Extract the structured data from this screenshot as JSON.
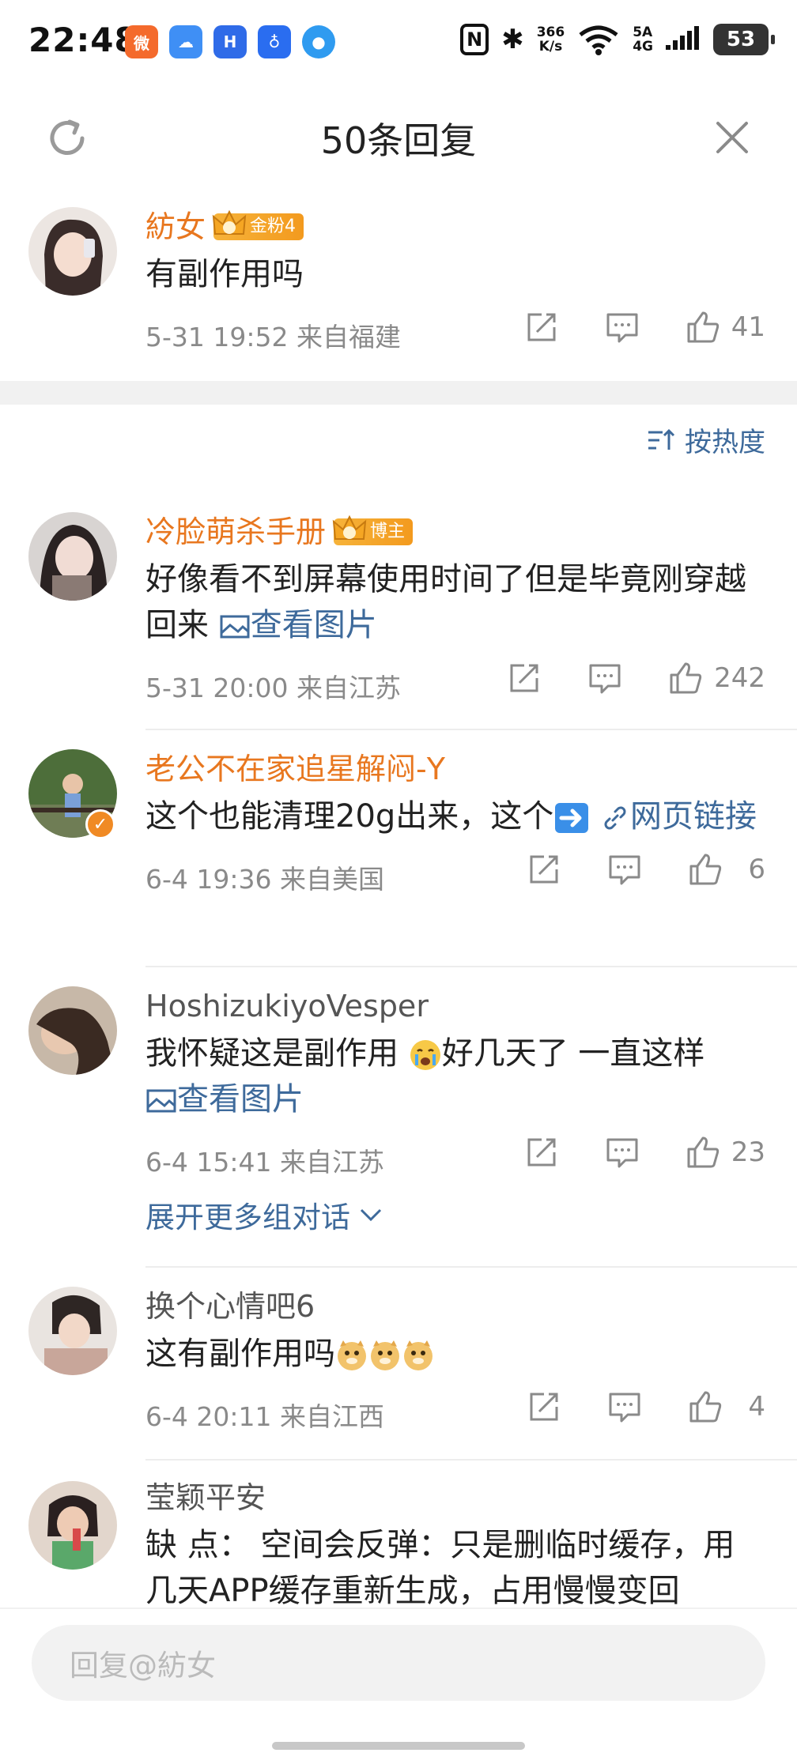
{
  "status_bar": {
    "time": "22:48",
    "net_speed_top": "366",
    "net_speed_bottom": "K/s",
    "signal_top": "5A",
    "signal_bottom": "4G",
    "battery": "53",
    "app_icon_colors": [
      "#f46a2c",
      "#3f8ff5",
      "#2f6be8",
      "#2a6df0",
      "#2f9bf0"
    ]
  },
  "header": {
    "title": "50条回复"
  },
  "root_comment": {
    "username": "紡女",
    "badge": "金粉4",
    "text": "有副作用吗",
    "meta": "5-31 19:52 来自福建",
    "likes": "41"
  },
  "sort": {
    "label": "按热度"
  },
  "comments": [
    {
      "username": "冷脸萌杀手册",
      "badge": "博主",
      "text": "好像看不到屏幕使用时间了但是毕竟刚穿越回来",
      "link_text": "查看图片",
      "meta": "5-31 20:00 来自江苏",
      "likes": "242"
    },
    {
      "username": "老公不在家追星解闷-Y",
      "text": "这个也能清理20g出来，这个",
      "link_text": "网页链接",
      "meta": "6-4 19:36 来自美国",
      "likes": "6"
    },
    {
      "username": "HoshizukiyoVesper",
      "text_a": "我怀疑这是副作用",
      "text_b": "好几天了 一直这样",
      "link_text": "查看图片",
      "meta": "6-4 15:41 来自江苏",
      "likes": "23",
      "expand": "展开更多组对话"
    },
    {
      "username": "换个心情吧6",
      "text": "这有副作用吗",
      "meta": "6-4 20:11 来自江西",
      "likes": "4"
    },
    {
      "username": "莹颖平安",
      "text": "缺 点：  空间会反弹：只是删临时缓存，用几天APP缓存重新生成，占用慢慢变回"
    }
  ],
  "reply_input": {
    "placeholder": "回复@紡女"
  },
  "colors": {
    "username_orange": "#e8771f",
    "link_blue": "#3e6a9b",
    "meta_gray": "#8a8a8a"
  }
}
